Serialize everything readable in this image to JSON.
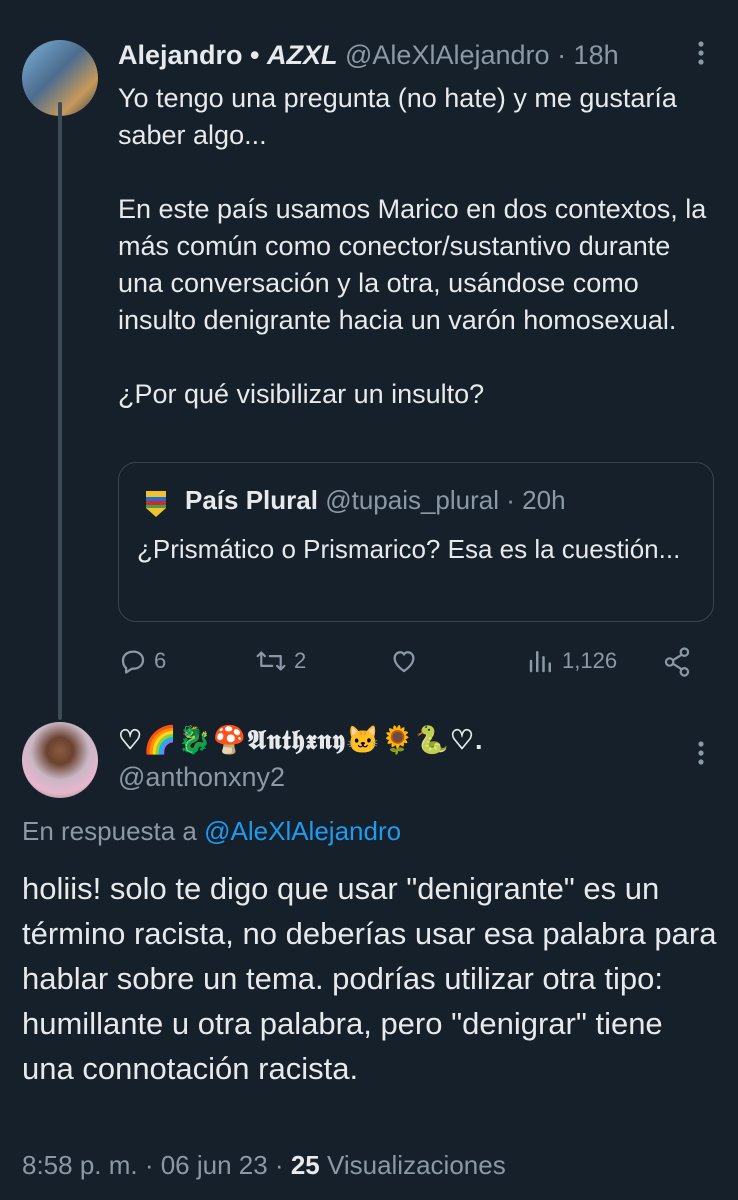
{
  "tweet1": {
    "name": "Alejandro",
    "separator": " • ",
    "affiliation": "AZXL",
    "handle": "@AleXlAlejandro",
    "time": "· 18h",
    "text": "Yo tengo una pregunta (no hate) y me gustaría saber algo...\n\nEn este país usamos Marico en dos contextos, la más común como conector/sustantivo durante una conversación y la otra, usándose como insulto denigrante hacia un varón homosexual.\n\n¿Por qué visibilizar un insulto?",
    "quote": {
      "name": "País Plural",
      "handle": "@tupais_plural",
      "time": "· 20h",
      "text": "¿Prismático o Prismarico? Esa es la cuestión..."
    },
    "actions": {
      "replies": "6",
      "retweets": "2",
      "views": "1,126"
    }
  },
  "tweet2": {
    "name": "♡🌈🐉🍄𝕬𝖓𝖙𝖍𝖝𝖓𝖞🐱🌻🐍♡.",
    "handle": "@anthonxny2",
    "reply_prefix": "En respuesta a ",
    "reply_handle": "@AleXlAlejandro",
    "text": "holiis! solo te digo que usar \"denigrante\" es un término racista, no deberías usar esa palabra para hablar sobre un tema. podrías utilizar otra tipo: humillante u otra palabra, pero \"denigrar\" tiene una connotación racista.",
    "meta_time": "8:58 p. m. · 06 jun 23 · ",
    "views_count": "25",
    "views_label": " Visualizaciones"
  },
  "colors": {
    "background": "#15202b",
    "text": "#e7e9ea",
    "muted": "#8b98a5",
    "link": "#1d9bf0"
  }
}
